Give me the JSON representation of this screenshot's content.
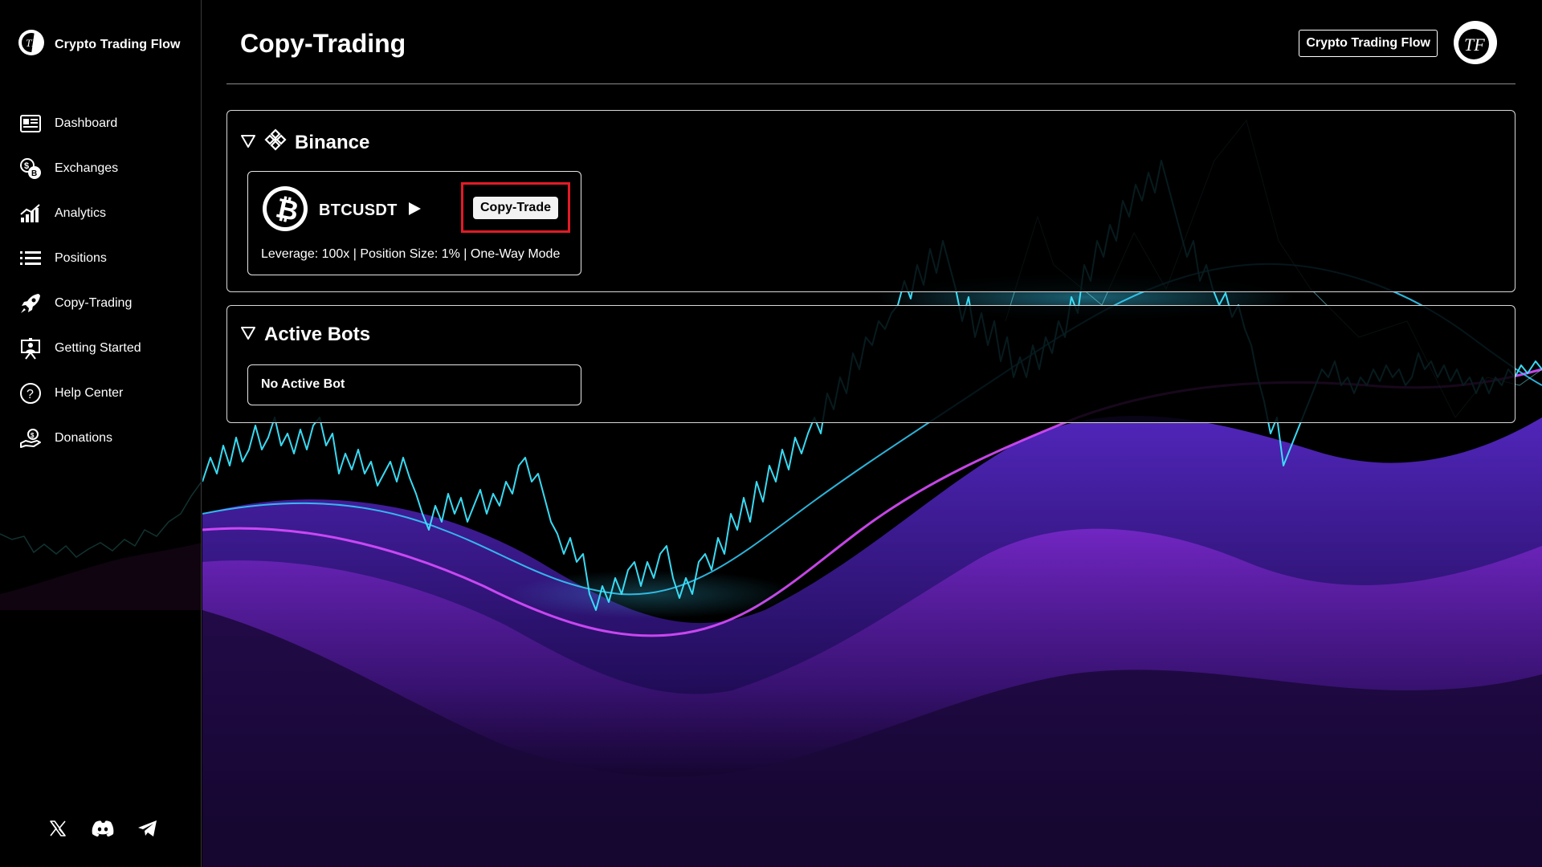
{
  "app": {
    "name": "Crypto Trading Flow",
    "logo_icon": "ctf-logo-icon"
  },
  "sidebar": {
    "items": [
      {
        "label": "Dashboard",
        "icon": "dashboard-icon"
      },
      {
        "label": "Exchanges",
        "icon": "exchanges-icon"
      },
      {
        "label": "Analytics",
        "icon": "analytics-icon"
      },
      {
        "label": "Positions",
        "icon": "list-icon"
      },
      {
        "label": "Copy-Trading",
        "icon": "rocket-icon"
      },
      {
        "label": "Getting Started",
        "icon": "presentation-icon"
      },
      {
        "label": "Help Center",
        "icon": "help-icon"
      },
      {
        "label": "Donations",
        "icon": "donation-icon"
      }
    ],
    "socials": [
      {
        "name": "X",
        "icon": "x-icon"
      },
      {
        "name": "Discord",
        "icon": "discord-icon"
      },
      {
        "name": "Telegram",
        "icon": "telegram-icon"
      }
    ]
  },
  "header": {
    "title": "Copy-Trading",
    "badge": "Crypto Trading Flow"
  },
  "sections": {
    "exchange": {
      "title": "Binance",
      "icon": "binance-icon",
      "pair": {
        "symbol": "BTCUSDT",
        "icon": "bitcoin-icon",
        "action_label": "Copy-Trade",
        "meta": "Leverage: 100x | Position Size: 1% | One-Way Mode"
      }
    },
    "bots": {
      "title": "Active Bots",
      "empty_text": "No Active Bot"
    }
  },
  "colors": {
    "background": "#000000",
    "highlight_border": "#e21b26",
    "chart_cyan": "#2fe3ff",
    "chart_magenta": "#c533ff",
    "wave_purple": "#3a1f8f"
  }
}
